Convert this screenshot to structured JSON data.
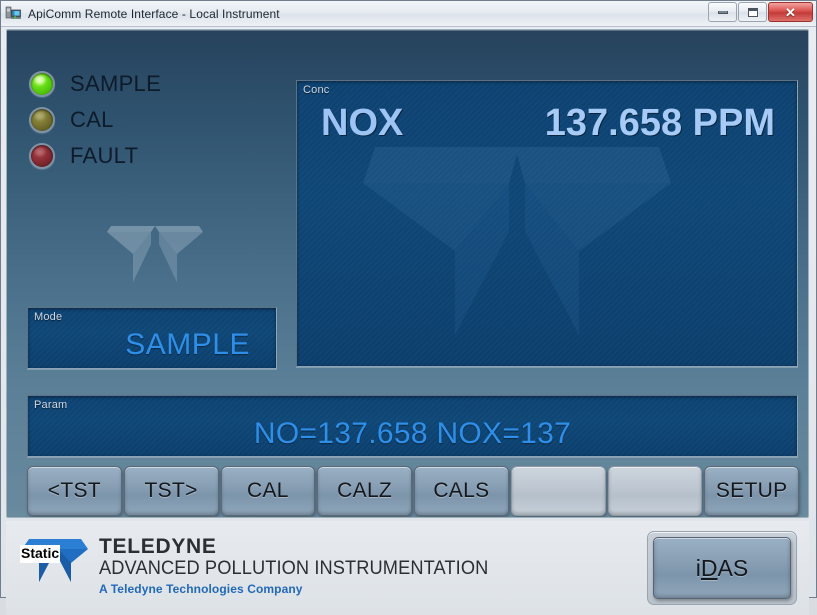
{
  "window": {
    "title": "ApiComm Remote Interface - Local Instrument",
    "icon": "network-instrument-icon",
    "controls": {
      "minimize": "minimize-button",
      "maximize": "maximize-button",
      "close_glyph": "✕"
    }
  },
  "status_leds": [
    {
      "label": "SAMPLE",
      "state": "active",
      "color": "#63dc14"
    },
    {
      "label": "CAL",
      "state": "inactive",
      "color": "#7a7530"
    },
    {
      "label": "FAULT",
      "state": "inactive",
      "color": "#8b2b33"
    }
  ],
  "conc": {
    "label": "Conc",
    "gas": "NOX",
    "value": "137.658 PPM"
  },
  "mode": {
    "label": "Mode",
    "value": "SAMPLE"
  },
  "param": {
    "label": "Param",
    "value": "NO=137.658 NOX=137"
  },
  "buttons": [
    {
      "label": "<TST",
      "enabled": true
    },
    {
      "label": "TST>",
      "enabled": true
    },
    {
      "label": "CAL",
      "enabled": true
    },
    {
      "label": "CALZ",
      "enabled": true
    },
    {
      "label": "CALS",
      "enabled": true
    },
    {
      "label": "",
      "enabled": false
    },
    {
      "label": "",
      "enabled": false
    },
    {
      "label": "SETUP",
      "enabled": true
    }
  ],
  "footer": {
    "static_tag": "Static",
    "brand_line1": "TELEDYNE",
    "brand_line2": "ADVANCED POLLUTION INSTRUMENTATION",
    "brand_line3": "A Teledyne Technologies Company",
    "logo": "teledyne-chevron-logo",
    "idas_pre": "i",
    "idas_accel": "D",
    "idas_post": "AS"
  },
  "colors": {
    "accent_blue": "#2f8fe8",
    "readout_bg": "#0e4778",
    "brand_blue": "#1f6ec2",
    "led_active": "#63dc14"
  }
}
